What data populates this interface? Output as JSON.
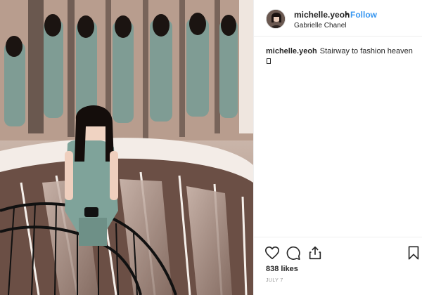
{
  "post": {
    "username": "michelle.yeoh",
    "separator": "•",
    "follow_label": "Follow",
    "location": "Gabrielle Chanel",
    "caption": {
      "username": "michelle.yeoh",
      "text": "Stairway to fashion heaven"
    },
    "likes": "838 likes",
    "date": "JULY 7"
  },
  "icons": {
    "like": "heart-icon",
    "comment": "comment-bubble-icon",
    "share": "share-icon",
    "save": "bookmark-icon"
  },
  "colors": {
    "follow_blue": "#3897f0",
    "text": "#262626",
    "muted": "#999999",
    "border": "#efefef"
  }
}
